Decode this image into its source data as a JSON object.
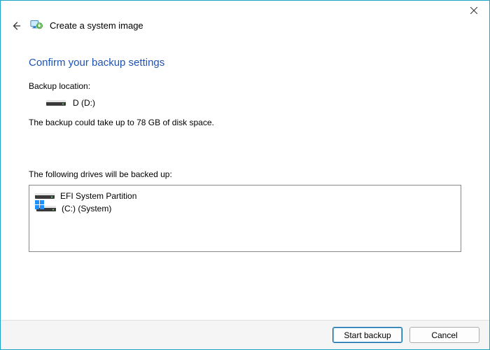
{
  "header": {
    "title": "Create a system image"
  },
  "main": {
    "heading": "Confirm your backup settings",
    "location_label": "Backup location:",
    "destination": "D (D:)",
    "size_note": "The backup could take up to 78 GB of disk space.",
    "drives_label": "The following drives will be backed up:",
    "drives": [
      {
        "label": "EFI System Partition",
        "has_win_badge": false
      },
      {
        "label": "(C:) (System)",
        "has_win_badge": true
      }
    ]
  },
  "footer": {
    "start_label": "Start backup",
    "cancel_label": "Cancel"
  }
}
